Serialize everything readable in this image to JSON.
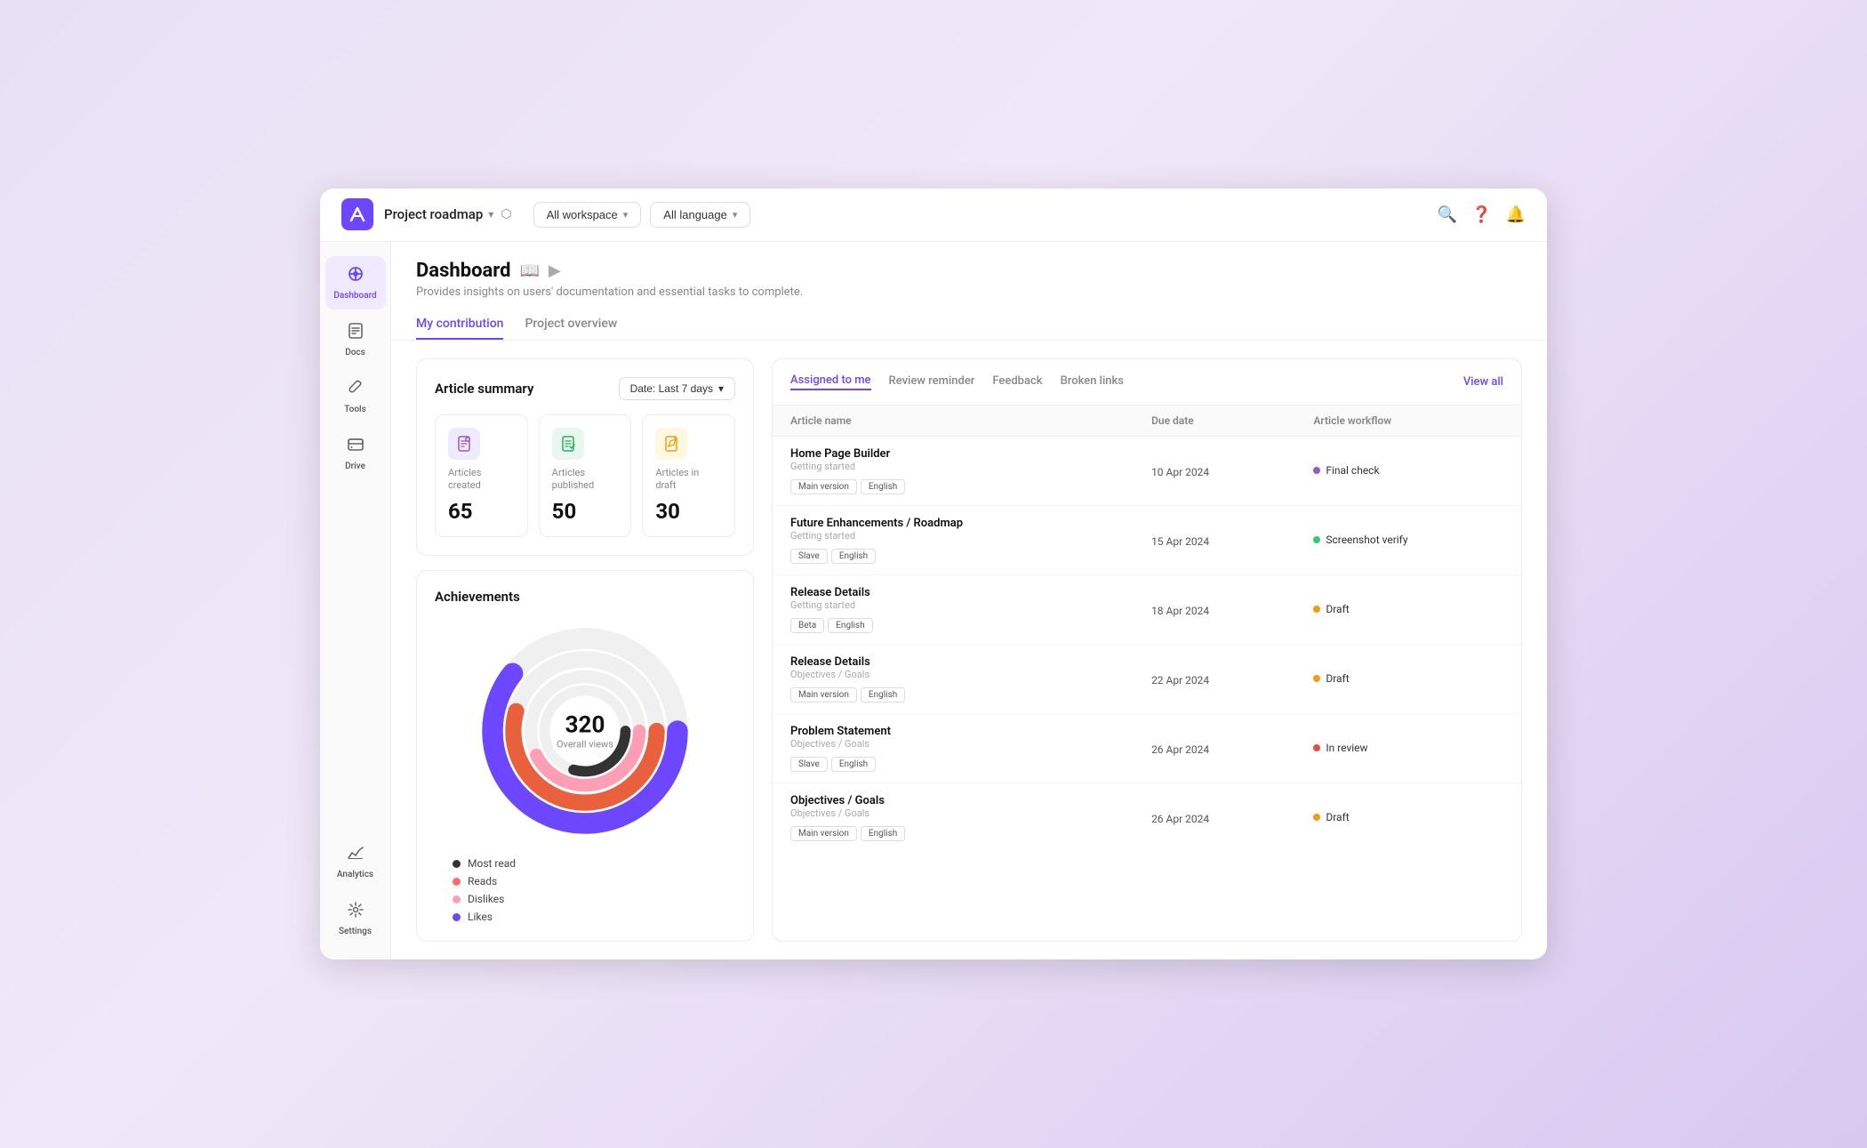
{
  "topbar": {
    "project_name": "Project roadmap",
    "workspace_filter": "All workspace",
    "language_filter": "All language"
  },
  "sidebar": {
    "items": [
      {
        "id": "dashboard",
        "label": "Dashboard",
        "icon": "🏠",
        "active": true
      },
      {
        "id": "docs",
        "label": "Docs",
        "icon": "📚",
        "active": false
      },
      {
        "id": "tools",
        "label": "Tools",
        "icon": "🔧",
        "active": false
      },
      {
        "id": "drive",
        "label": "Drive",
        "icon": "🗄️",
        "active": false
      },
      {
        "id": "analytics",
        "label": "Analytics",
        "icon": "📊",
        "active": false
      },
      {
        "id": "settings",
        "label": "Settings",
        "icon": "⚙️",
        "active": false
      }
    ]
  },
  "page": {
    "title": "Dashboard",
    "subtitle": "Provides insights on users' documentation and essential tasks to complete.",
    "tabs": [
      {
        "id": "my-contribution",
        "label": "My contribution",
        "active": true
      },
      {
        "id": "project-overview",
        "label": "Project overview",
        "active": false
      }
    ]
  },
  "article_summary": {
    "title": "Article summary",
    "date_filter": "Date:  Last 7 days",
    "stats": [
      {
        "id": "created",
        "label": "Articles created",
        "value": "65",
        "icon": "📄",
        "color": "purple"
      },
      {
        "id": "published",
        "label": "Articles published",
        "value": "50",
        "icon": "📋",
        "color": "green"
      },
      {
        "id": "draft",
        "label": "Articles in draft",
        "value": "30",
        "icon": "✏️",
        "color": "yellow"
      }
    ]
  },
  "achievements": {
    "title": "Achievements",
    "overall_views_value": "320",
    "overall_views_label": "Overall views",
    "legend": [
      {
        "label": "Most read",
        "color": "#333333"
      },
      {
        "label": "Reads",
        "color": "#ff6b6b"
      },
      {
        "label": "Dislikes",
        "color": "#ff9eb5"
      },
      {
        "label": "Likes",
        "color": "#6c47ff"
      }
    ]
  },
  "assigned": {
    "tabs": [
      {
        "id": "assigned",
        "label": "Assigned to me",
        "active": true
      },
      {
        "id": "review",
        "label": "Review reminder",
        "active": false
      },
      {
        "id": "feedback",
        "label": "Feedback",
        "active": false
      },
      {
        "id": "broken",
        "label": "Broken links",
        "active": false
      }
    ],
    "view_all": "View all",
    "columns": [
      "Article name",
      "Due date",
      "Article workflow"
    ],
    "rows": [
      {
        "name": "Home Page Builder",
        "category": "Getting started",
        "tags": [
          "Main version",
          "English"
        ],
        "due_date": "10 Apr 2024",
        "workflow": "Final check",
        "workflow_color": "#9b59b6"
      },
      {
        "name": "Future Enhancements / Roadmap",
        "category": "Getting started",
        "tags": [
          "Slave",
          "English"
        ],
        "due_date": "15 Apr 2024",
        "workflow": "Screenshot verify",
        "workflow_color": "#2ecc71"
      },
      {
        "name": "Release Details",
        "category": "Getting started",
        "tags": [
          "Beta",
          "English"
        ],
        "due_date": "18 Apr 2024",
        "workflow": "Draft",
        "workflow_color": "#f39c12"
      },
      {
        "name": "Release Details",
        "category": "Objectives / Goals",
        "tags": [
          "Main version",
          "English"
        ],
        "due_date": "22 Apr 2024",
        "workflow": "Draft",
        "workflow_color": "#f39c12"
      },
      {
        "name": "Problem Statement",
        "category": "Objectives / Goals",
        "tags": [
          "Slave",
          "English"
        ],
        "due_date": "26 Apr 2024",
        "workflow": "In review",
        "workflow_color": "#e74c3c"
      },
      {
        "name": "Objectives / Goals",
        "category": "Objectives / Goals",
        "tags": [
          "Main version",
          "English"
        ],
        "due_date": "26 Apr 2024",
        "workflow": "Draft",
        "workflow_color": "#f39c12"
      }
    ]
  }
}
